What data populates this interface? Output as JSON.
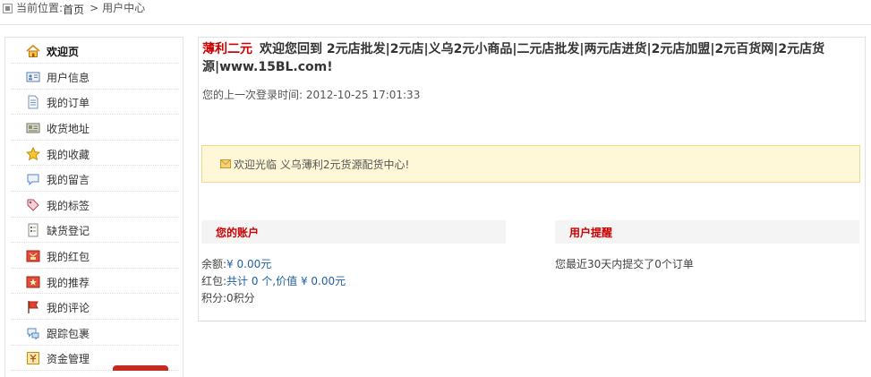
{
  "breadcrumb": {
    "prefix": "当前位置:",
    "home": "首页",
    "separator": ">",
    "current": "用户中心"
  },
  "sidebar": {
    "items": [
      {
        "label": "欢迎页",
        "icon": "home-icon",
        "active": true
      },
      {
        "label": "用户信息",
        "icon": "id-card-icon"
      },
      {
        "label": "我的订单",
        "icon": "document-icon"
      },
      {
        "label": "收货地址",
        "icon": "address-book-icon"
      },
      {
        "label": "我的收藏",
        "icon": "star-icon"
      },
      {
        "label": "我的留言",
        "icon": "speech-bubble-icon"
      },
      {
        "label": "我的标签",
        "icon": "tag-icon"
      },
      {
        "label": "缺货登记",
        "icon": "form-icon"
      },
      {
        "label": "我的红包",
        "icon": "red-packet-icon"
      },
      {
        "label": "我的推荐",
        "icon": "recommend-icon"
      },
      {
        "label": "我的评论",
        "icon": "flag-icon"
      },
      {
        "label": "跟踪包裹",
        "icon": "package-tracking-icon"
      },
      {
        "label": "资金管理",
        "icon": "funds-icon"
      }
    ]
  },
  "welcome": {
    "shop_name": "薄利二元",
    "message": "欢迎您回到 2元店批发|2元店|义乌2元小商品|二元店批发|两元店进货|2元店加盟|2元百货网|2元店货源|www.15BL.com!",
    "last_login_label": "您的上一次登录时间:",
    "last_login_time": "2012-10-25 17:01:33"
  },
  "notice": {
    "text": "欢迎光临 义乌薄利2元货源配货中心!"
  },
  "account": {
    "title": "您的账户",
    "balance_label": "余额:",
    "balance_value": "¥ 0.00元",
    "bonus_label": "红包:",
    "bonus_value": "共计 0 个,价值 ¥ 0.00元",
    "points_label": "积分:",
    "points_value": "0积分"
  },
  "reminder": {
    "title": "用户提醒",
    "text": "您最近30天内提交了0个订单"
  },
  "colors": {
    "accent_red": "#cc0000",
    "link_blue": "#1f5fa3",
    "notice_bg": "#fff8d8",
    "notice_border": "#f0d98a",
    "panel_bg": "#f4f4f4"
  }
}
